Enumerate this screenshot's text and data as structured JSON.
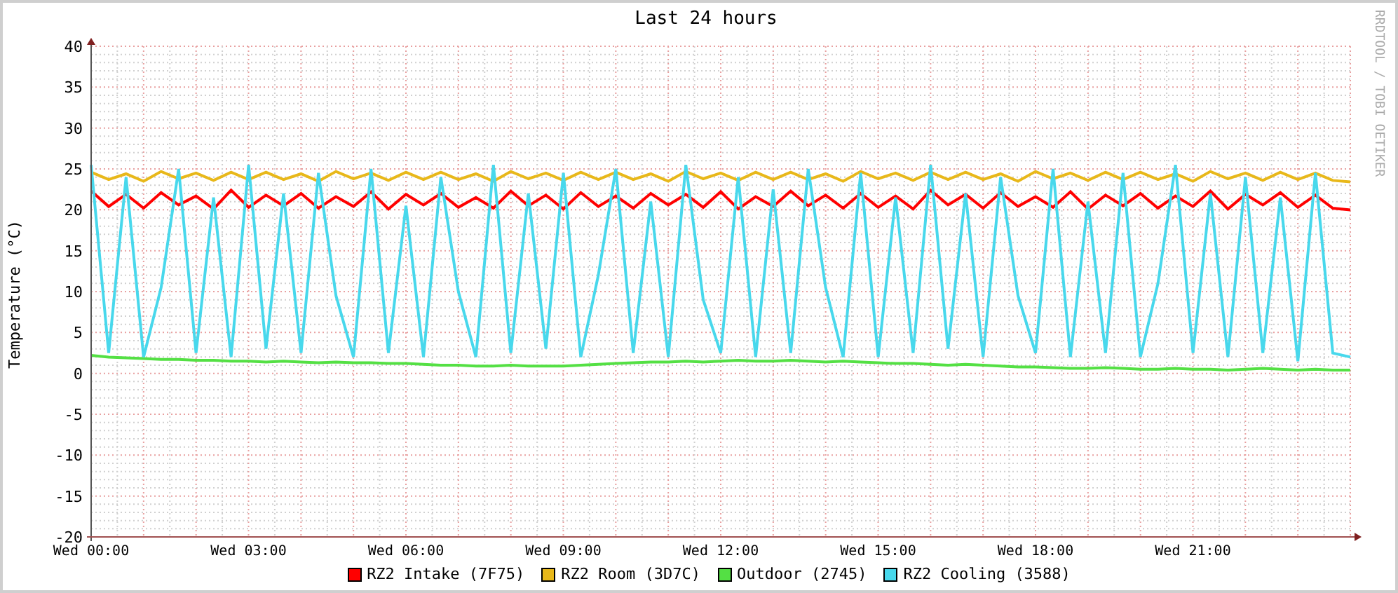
{
  "chart": {
    "chart_data": {
      "type": "line",
      "title": "Last 24 hours",
      "ylabel": "Temperature (°C)",
      "categories": [
        "Wed 00:00",
        null,
        null,
        null,
        null,
        null,
        null,
        null,
        null,
        "Wed 03:00",
        null,
        null,
        null,
        null,
        null,
        null,
        null,
        null,
        "Wed 06:00",
        null,
        null,
        null,
        null,
        null,
        null,
        null,
        null,
        "Wed 09:00",
        null,
        null,
        null,
        null,
        null,
        null,
        null,
        null,
        "Wed 12:00",
        null,
        null,
        null,
        null,
        null,
        null,
        null,
        null,
        "Wed 15:00",
        null,
        null,
        null,
        null,
        null,
        null,
        null,
        null,
        "Wed 18:00",
        null,
        null,
        null,
        null,
        null,
        null,
        null,
        null,
        "Wed 21:00",
        null,
        null,
        null,
        null,
        null,
        null,
        null,
        null,
        null
      ],
      "ylim": [
        -20,
        40
      ],
      "grid": true,
      "yticks": [
        -20,
        -15,
        -10,
        -5,
        0,
        5,
        10,
        15,
        20,
        25,
        30,
        35,
        40
      ],
      "series": [
        {
          "name": "RZ2 Intake (7F75)",
          "color": "#ff0000",
          "values": [
            22.3,
            20.4,
            21.9,
            20.2,
            22.1,
            20.6,
            21.7,
            20.1,
            22.4,
            20.3,
            21.8,
            20.5,
            22.0,
            20.2,
            21.6,
            20.4,
            22.2,
            20.1,
            21.9,
            20.6,
            22.0,
            20.3,
            21.5,
            20.2,
            22.3,
            20.5,
            21.8,
            20.1,
            22.1,
            20.4,
            21.7,
            20.2,
            22.0,
            20.6,
            21.9,
            20.3,
            22.2,
            20.1,
            21.6,
            20.4,
            22.3,
            20.5,
            21.8,
            20.2,
            22.0,
            20.3,
            21.7,
            20.1,
            22.4,
            20.6,
            21.9,
            20.2,
            22.1,
            20.4,
            21.6,
            20.3,
            22.2,
            20.1,
            21.8,
            20.5,
            22.0,
            20.2,
            21.7,
            20.4,
            22.3,
            20.1,
            21.9,
            20.6,
            22.1,
            20.3,
            21.8,
            20.2,
            20.0
          ]
        },
        {
          "name": "RZ2 Room (3D7C)",
          "color": "#e8b81a",
          "values": [
            24.6,
            23.7,
            24.4,
            23.5,
            24.7,
            23.8,
            24.5,
            23.6,
            24.6,
            23.7,
            24.6,
            23.7,
            24.4,
            23.5,
            24.7,
            23.8,
            24.5,
            23.6,
            24.6,
            23.7,
            24.6,
            23.7,
            24.4,
            23.5,
            24.7,
            23.8,
            24.5,
            23.6,
            24.6,
            23.7,
            24.6,
            23.7,
            24.4,
            23.5,
            24.7,
            23.8,
            24.5,
            23.6,
            24.6,
            23.7,
            24.6,
            23.7,
            24.4,
            23.5,
            24.7,
            23.8,
            24.5,
            23.6,
            24.6,
            23.7,
            24.6,
            23.7,
            24.4,
            23.5,
            24.7,
            23.8,
            24.5,
            23.6,
            24.6,
            23.7,
            24.6,
            23.7,
            24.4,
            23.5,
            24.7,
            23.8,
            24.5,
            23.6,
            24.6,
            23.7,
            24.5,
            23.6,
            23.4
          ]
        },
        {
          "name": "Outdoor (2745)",
          "color": "#54e044",
          "values": [
            2.2,
            2.0,
            1.9,
            1.8,
            1.7,
            1.7,
            1.6,
            1.6,
            1.5,
            1.5,
            1.4,
            1.5,
            1.4,
            1.3,
            1.4,
            1.3,
            1.3,
            1.2,
            1.2,
            1.1,
            1.0,
            1.0,
            0.9,
            0.9,
            1.0,
            0.9,
            0.9,
            0.9,
            1.0,
            1.1,
            1.2,
            1.3,
            1.4,
            1.4,
            1.5,
            1.4,
            1.5,
            1.6,
            1.5,
            1.5,
            1.6,
            1.5,
            1.4,
            1.5,
            1.4,
            1.3,
            1.2,
            1.2,
            1.1,
            1.0,
            1.1,
            1.0,
            0.9,
            0.8,
            0.8,
            0.7,
            0.6,
            0.6,
            0.7,
            0.6,
            0.5,
            0.5,
            0.6,
            0.5,
            0.5,
            0.4,
            0.5,
            0.6,
            0.5,
            0.4,
            0.5,
            0.4,
            0.4
          ]
        },
        {
          "name": "RZ2 Cooling (3588)",
          "color": "#48d8ec",
          "values": [
            25.5,
            2.5,
            24.0,
            2.0,
            10.5,
            25.0,
            2.5,
            21.5,
            2.0,
            25.5,
            3.0,
            22.0,
            2.5,
            24.5,
            9.5,
            2.0,
            25.0,
            2.5,
            20.5,
            2.0,
            24.0,
            10.0,
            2.0,
            25.5,
            2.5,
            22.0,
            3.0,
            24.5,
            2.0,
            12.0,
            25.0,
            2.5,
            21.0,
            2.0,
            25.5,
            9.0,
            2.5,
            24.0,
            2.0,
            22.5,
            2.5,
            25.0,
            10.5,
            2.0,
            24.5,
            2.0,
            21.5,
            2.5,
            25.5,
            3.0,
            22.0,
            2.0,
            24.0,
            9.5,
            2.5,
            25.0,
            2.0,
            21.0,
            2.5,
            24.5,
            2.0,
            11.0,
            25.5,
            2.5,
            22.0,
            2.0,
            24.0,
            2.5,
            21.5,
            1.5,
            24.5,
            2.5,
            2.0
          ]
        }
      ]
    }
  },
  "credit": "RRDTOOL / TOBI OETIKER"
}
